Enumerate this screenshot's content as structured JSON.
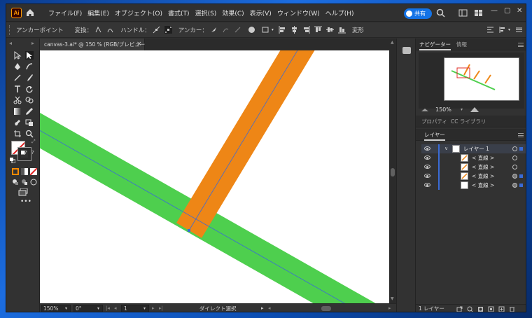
{
  "menubar": {
    "app_logo": "Ai",
    "items": [
      "ファイル(F)",
      "編集(E)",
      "オブジェクト(O)",
      "書式(T)",
      "選択(S)",
      "効果(C)",
      "表示(V)",
      "ウィンドウ(W)",
      "ヘルプ(H)"
    ],
    "share_label": "共有"
  },
  "controlbar": {
    "tool_name": "アンカーポイント",
    "convert_label": "変換：",
    "handle_label": "ハンドル：",
    "anchor_label": "アンカー：",
    "transform_label": "変形"
  },
  "document": {
    "tab_title": "canvas-3.ai* @ 150 % (RGB/プレビュー)",
    "tab_close": "×"
  },
  "status": {
    "zoom": "150%",
    "rotation": "0°",
    "artboard_number": "1",
    "tool_status": "ダイレクト選択"
  },
  "navigator": {
    "tabs": [
      "ナビゲーター",
      "情報"
    ],
    "zoom": "150%"
  },
  "properties_tabs": [
    "プロパティ",
    "CC ライブラリ"
  ],
  "layers": {
    "tab": "レイヤー",
    "rows": [
      {
        "name": "レイヤー 1",
        "level": 0,
        "selected": true
      },
      {
        "name": "< 直線 >",
        "level": 1,
        "selected": false
      },
      {
        "name": "< 直線 >",
        "level": 1,
        "selected": false
      },
      {
        "name": "< 直線 >",
        "level": 1,
        "selected": true
      },
      {
        "name": "< 直線 >",
        "level": 1,
        "selected": true
      }
    ],
    "count_label": "1 レイヤー"
  },
  "colors": {
    "green_stroke": "#4ecf4e",
    "orange_stroke": "#ee8616",
    "selection_blue": "#3a6bd6",
    "share_blue": "#1473e6"
  }
}
